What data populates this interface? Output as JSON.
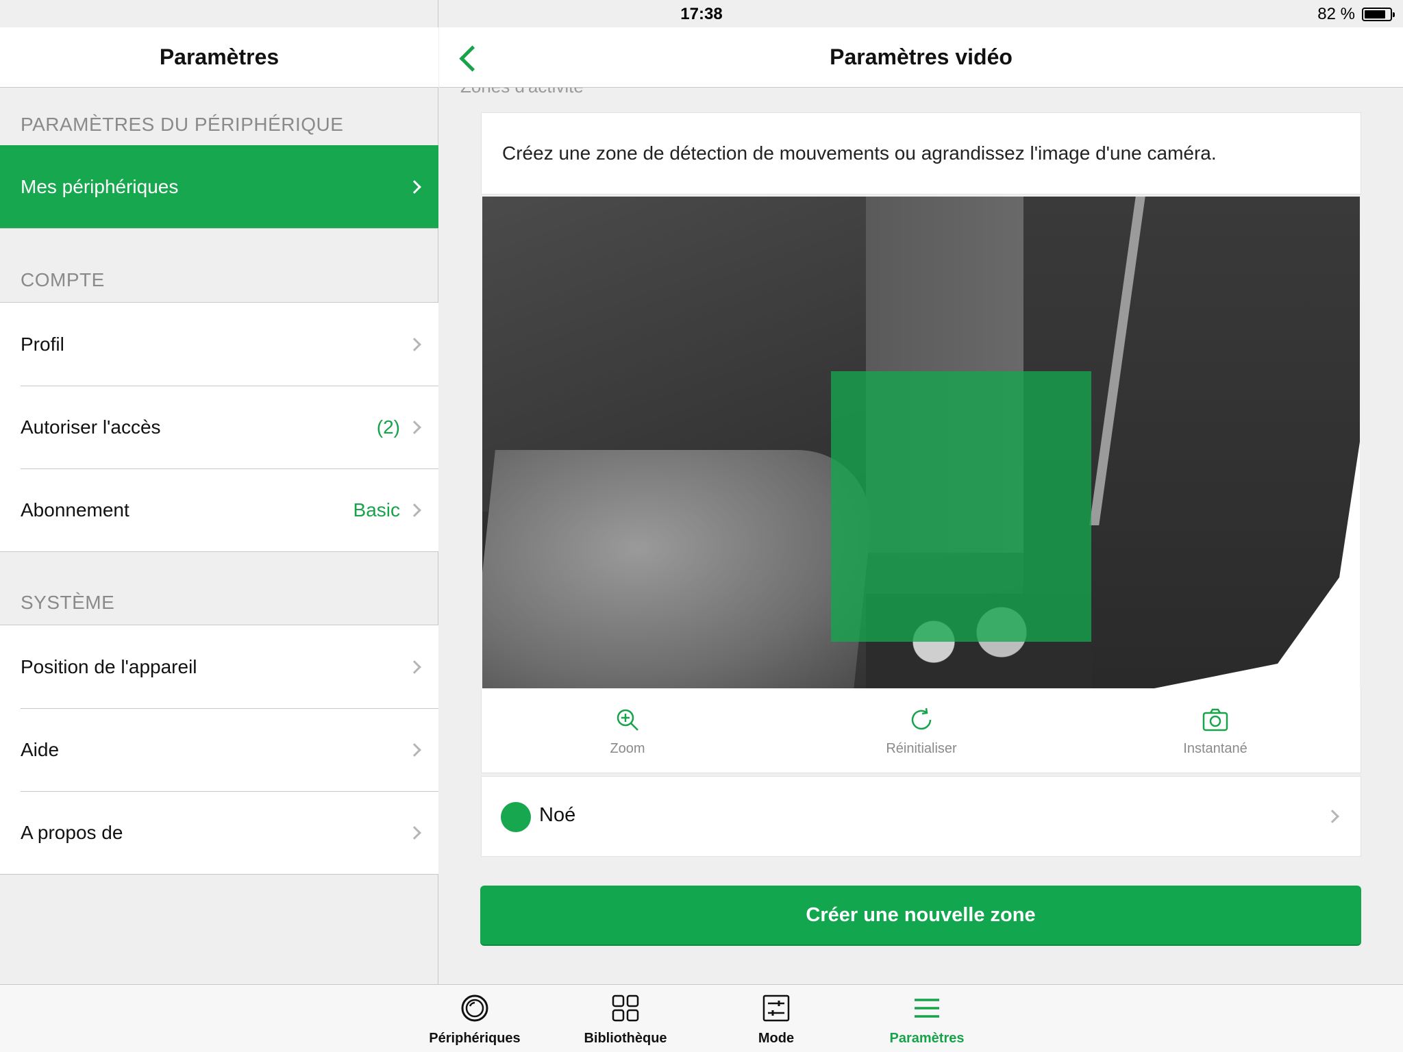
{
  "status_bar": {
    "device": "iPad",
    "time": "17:38",
    "battery": "82 %",
    "battery_level": 0.82
  },
  "left": {
    "title": "Paramètres",
    "sections": [
      {
        "title": "PARAMÈTRES DU PÉRIPHÉRIQUE",
        "items": [
          {
            "label": "Mes périphériques",
            "value": ""
          }
        ]
      },
      {
        "title": "COMPTE",
        "items": [
          {
            "label": "Profil",
            "value": ""
          },
          {
            "label": "Autoriser l'accès",
            "value": "(2)"
          },
          {
            "label": "Abonnement",
            "value": "Basic"
          }
        ]
      },
      {
        "title": "SYSTÈME",
        "items": [
          {
            "label": "Position de l'appareil",
            "value": ""
          },
          {
            "label": "Aide",
            "value": ""
          },
          {
            "label": "A propos de",
            "value": ""
          }
        ]
      }
    ]
  },
  "right": {
    "title": "Paramètres vidéo",
    "section_title": "Zones d'activité",
    "description": "Créez une zone de détection de mouvements ou agrandissez l'image d'une caméra.",
    "actions": {
      "zoom": "Zoom",
      "reset": "Réinitialiser",
      "snapshot": "Instantané"
    },
    "zone": {
      "name": "Noé",
      "color": "#16a74f"
    },
    "create_button": "Créer une nouvelle zone"
  },
  "tabbar": {
    "tabs": [
      {
        "label": "Périphériques",
        "icon": "camera-icon"
      },
      {
        "label": "Bibliothèque",
        "icon": "grid-icon"
      },
      {
        "label": "Mode",
        "icon": "sliders-icon"
      },
      {
        "label": "Paramètres",
        "icon": "menu-icon"
      }
    ],
    "active": "Paramètres"
  },
  "colors": {
    "accent": "#16a74f",
    "accent_text": "#16a34a",
    "muted": "#8a8a8a"
  }
}
